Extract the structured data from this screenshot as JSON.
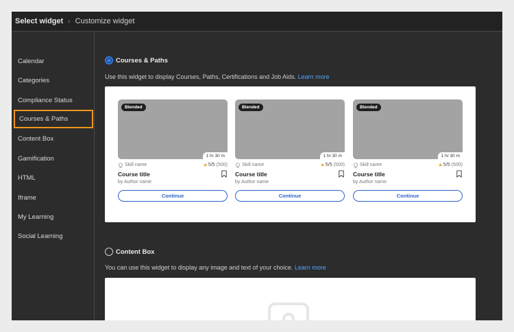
{
  "breadcrumb": {
    "current": "Select widget",
    "separator": "›",
    "next": "Customize widget"
  },
  "sidebar": {
    "items": [
      {
        "label": "Calendar",
        "active": false
      },
      {
        "label": "Categories",
        "active": false
      },
      {
        "label": "Compliance Status",
        "active": false
      },
      {
        "label": "Courses & Paths",
        "active": true
      },
      {
        "label": "Content Box",
        "active": false
      },
      {
        "label": "Gamification",
        "active": false
      },
      {
        "label": "HTML",
        "active": false
      },
      {
        "label": "Iframe",
        "active": false
      },
      {
        "label": "My Learning",
        "active": false
      },
      {
        "label": "Social Learning",
        "active": false
      }
    ]
  },
  "widgets": {
    "courses_paths": {
      "label": "Courses & Paths",
      "selected": true,
      "description": "Use this widget to display Courses, Paths, Certifications and Job Aids.",
      "learn_more": "Learn more",
      "cards": [
        {
          "badge": "Blended",
          "duration": "1 hr 30 m",
          "skill": "Skill name",
          "rating": "5/5",
          "rating_count": "(500)",
          "title": "Course title",
          "author": "by Author name",
          "button": "Continue"
        },
        {
          "badge": "Blended",
          "duration": "1 hr 30 m",
          "skill": "Skill name",
          "rating": "5/5",
          "rating_count": "(500)",
          "title": "Course title",
          "author": "by Author name",
          "button": "Continue"
        },
        {
          "badge": "Blended",
          "duration": "1 hr 30 m",
          "skill": "Skill name",
          "rating": "5/5",
          "rating_count": "(500)",
          "title": "Course title",
          "author": "by Author name",
          "button": "Continue"
        }
      ]
    },
    "content_box": {
      "label": "Content Box",
      "selected": false,
      "description": "You can use this widget to display any image and text of your choice.",
      "learn_more": "Learn more"
    }
  },
  "colors": {
    "accent": "#2f7ff0",
    "highlight": "#f0951e",
    "link": "#56a3f5",
    "background": "#2c2c2c"
  },
  "icons": {
    "separator": "chevron-right-icon",
    "skill": "lightbulb-icon",
    "rating": "star-icon",
    "bookmark": "bookmark-icon",
    "placeholder": "image-placeholder-icon"
  }
}
